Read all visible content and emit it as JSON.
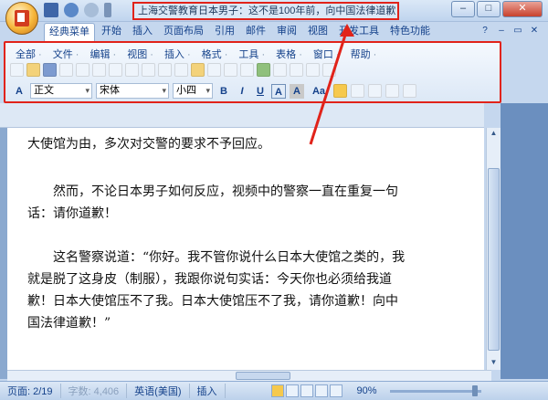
{
  "title": "上海交警教育日本男子：这不是100年前，向中国法律道歉！_",
  "tabs": [
    "经典菜单",
    "开始",
    "插入",
    "页面布局",
    "引用",
    "邮件",
    "审阅",
    "视图",
    "开发工具",
    "特色功能"
  ],
  "menus": [
    "全部",
    "文件",
    "编辑",
    "视图",
    "插入",
    "格式",
    "工具",
    "表格",
    "窗口",
    "帮助"
  ],
  "format": {
    "style": "正文",
    "font": "宋体",
    "size": "小四"
  },
  "format_buttons": [
    "B",
    "I",
    "U",
    "A",
    "A",
    "Aa"
  ],
  "paragraphs": [
    "大使馆为由，多次对交警的要求不予回应。",
    "然而，不论日本男子如何反应，视频中的警察一直在重复一句话：请你道歉！",
    "这名警察说道：“你好。我不管你说什么日本大使馆之类的，我就是脱了这身皮（制服），我跟你说句实话：今天你也必须给我道歉！日本大使馆压不了我。日本大使馆压不了我，请你道歉！向中国法律道歉！”"
  ],
  "status": {
    "page": "页面: 2/19",
    "words": "字数: 4,406",
    "lang": "英语(美国)",
    "mode": "插入",
    "zoom": "90%"
  },
  "colors": {
    "highlight": "#e1231a",
    "ribbon": "#dce8f6"
  }
}
